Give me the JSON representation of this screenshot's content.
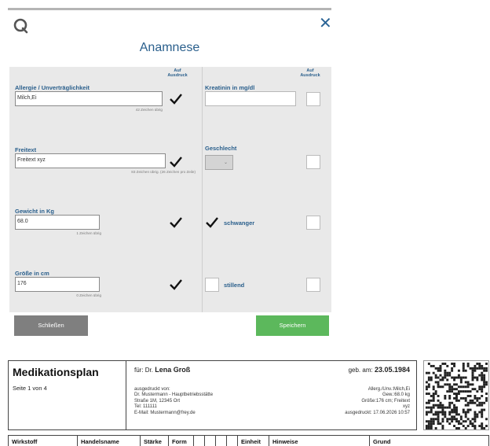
{
  "dialog": {
    "title": "Anamnese",
    "close_glyph": "✕",
    "column_header": "Auf\nAusdruck",
    "left": {
      "allergy": {
        "label": "Allergie / Unverträglichkeit",
        "value": "Milch,Ei",
        "hint": "42 Zeichen übrig",
        "print": true
      },
      "freetext": {
        "label": "Freitext",
        "value": "Freitext xyz",
        "hint": "83 Zeichen übrig. (26 Zeichen pro Zeile)",
        "print": true
      },
      "weight": {
        "label": "Gewicht in Kg",
        "value": "68.0",
        "hint": "1 Zeichen übrig",
        "print": true
      },
      "height": {
        "label": "Größe in cm",
        "value": "176",
        "hint": "0 Zeichen übrig",
        "print": true
      }
    },
    "right": {
      "creatinine": {
        "label": "Kreatinin in mg/dl",
        "value": "",
        "print": false
      },
      "gender": {
        "label": "Geschlecht",
        "value": "",
        "print": false
      },
      "pregnant": {
        "label": "schwanger",
        "checked": true,
        "print": false
      },
      "breastfeeding": {
        "label": "stillend",
        "checked": false,
        "print": false
      }
    },
    "buttons": {
      "close": "Schließen",
      "save": "Speichern"
    },
    "colors": {
      "accent": "#2a5f8c",
      "save": "#5cb85c",
      "close": "#7f7f7f",
      "panel": "#e9e9e9"
    }
  },
  "plan": {
    "title": "Medikationsplan",
    "page": "Seite 1 von 4",
    "for_prefix": "für: Dr.",
    "patient_name": "Lena  Groß",
    "dob_prefix": "geb. am:",
    "dob": "23.05.1984",
    "printed_by": [
      "ausgedruckt von:",
      "Dr. Mustermann - Hauptbetriebsstätte",
      "Straße  1M, 12345 Ort",
      "Tel: 111111",
      "E-Mail: Mustermann@frey.de"
    ],
    "summary": [
      "Allerg./Unv.:Milch,Ei",
      "Gew.:68.0 kg",
      "Größe:176 cm; Freitext",
      "xyz",
      "ausgedruckt: 17.06.2026 10:57"
    ],
    "columns": [
      "Wirkstoff",
      "Handelsname",
      "Stärke",
      "Form",
      "",
      "",
      "",
      "",
      "Einheit",
      "Hinweise",
      "Grund"
    ]
  }
}
